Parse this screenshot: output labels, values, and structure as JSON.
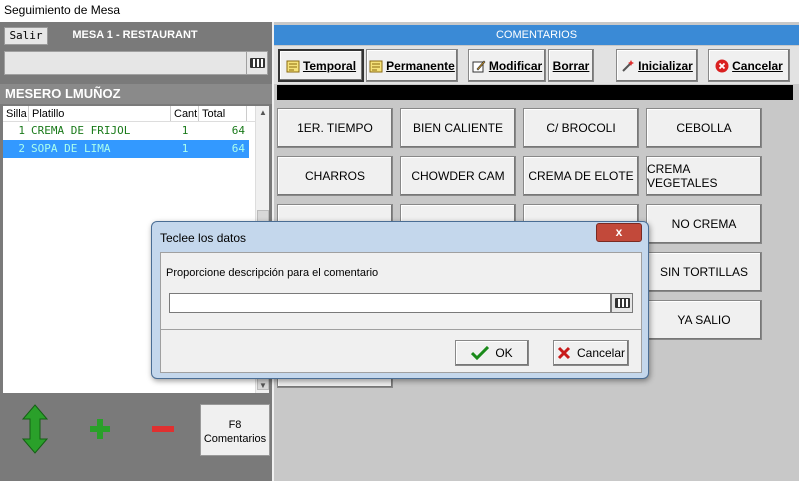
{
  "window": {
    "title": "Seguimiento de Mesa"
  },
  "left": {
    "salir_label": "Salir",
    "mesa_title": "MESA 1 - RESTAURANT",
    "search_value": "",
    "mesero": "MESERO LMUÑOZ",
    "columns": [
      "Silla",
      "Platillo",
      "Cant",
      "Total"
    ],
    "rows": [
      {
        "silla": "1",
        "platillo": "CREMA DE FRIJOL",
        "cant": "1",
        "total": "64"
      },
      {
        "silla": "2",
        "platillo": "SOPA DE LIMA",
        "cant": "1",
        "total": "64"
      }
    ],
    "f8_line1": "F8",
    "f8_line2": "Comentarios"
  },
  "right": {
    "title": "COMENTARIOS",
    "toolbar": {
      "temporal": "Temporal",
      "permanente": "Permanente",
      "modificar": "Modificar",
      "borrar": "Borrar",
      "inicializar": "Inicializar",
      "cancelar": "Cancelar"
    },
    "buttons": [
      "1ER. TIEMPO",
      "BIEN CALIENTE",
      "C/ BROCOLI",
      "CEBOLLA",
      "CHARROS",
      "CHOWDER CAM",
      "CREMA DE ELOTE",
      "CREMA VEGETALES",
      "NO CREMA",
      "SIN TORTILLAS",
      "YA SALIO"
    ]
  },
  "dialog": {
    "title": "Teclee los datos",
    "close_label": "x",
    "prompt": "Proporcione descripción para el comentario",
    "input_value": "",
    "ok_label": "OK",
    "cancel_label": "Cancelar"
  },
  "colors": {
    "accent": "#3a8ad6",
    "selected_row": "#3399ff",
    "row_text": "#1a7a1a",
    "panel_gray": "#7a7a7a"
  }
}
